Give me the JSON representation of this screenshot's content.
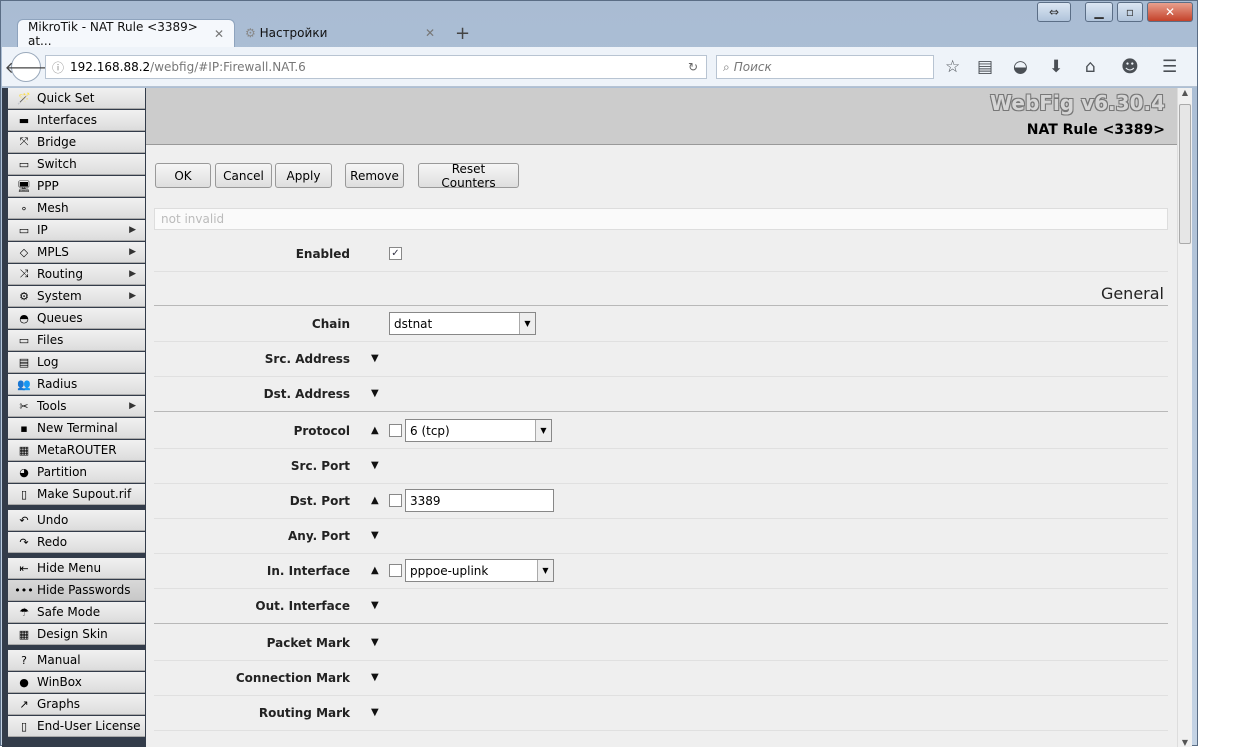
{
  "browser": {
    "tabs": [
      {
        "label": "MikroTik - NAT Rule <3389> at..."
      },
      {
        "label": "Настройки"
      }
    ],
    "new_tab": "+",
    "close": "✕",
    "url_domain": "192.168.88.2",
    "url_path": "/webfig/#IP:Firewall.NAT.6",
    "search_placeholder": "Поиск"
  },
  "sidebar": {
    "items": [
      {
        "label": "Quick Set",
        "icon": "🪄"
      },
      {
        "label": "Interfaces",
        "icon": "▬"
      },
      {
        "label": "Bridge",
        "icon": "⤧"
      },
      {
        "label": "Switch",
        "icon": "▭"
      },
      {
        "label": "PPP",
        "icon": "🖥"
      },
      {
        "label": "Mesh",
        "icon": "∘"
      },
      {
        "label": "IP",
        "icon": "▭",
        "sub": true
      },
      {
        "label": "MPLS",
        "icon": "◇",
        "sub": true
      },
      {
        "label": "Routing",
        "icon": "⤨",
        "sub": true
      },
      {
        "label": "System",
        "icon": "⚙",
        "sub": true
      },
      {
        "label": "Queues",
        "icon": "◓"
      },
      {
        "label": "Files",
        "icon": "▭"
      },
      {
        "label": "Log",
        "icon": "▤"
      },
      {
        "label": "Radius",
        "icon": "👥"
      },
      {
        "label": "Tools",
        "icon": "✂",
        "sub": true
      },
      {
        "label": "New Terminal",
        "icon": "▪"
      },
      {
        "label": "MetaROUTER",
        "icon": "▦"
      },
      {
        "label": "Partition",
        "icon": "◕"
      },
      {
        "label": "Make Supout.rif",
        "icon": "▯"
      },
      {
        "label": "Undo",
        "icon": "↶"
      },
      {
        "label": "Redo",
        "icon": "↷"
      },
      {
        "label": "Hide Menu",
        "icon": "⇤"
      },
      {
        "label": "Hide Passwords",
        "icon": "•••"
      },
      {
        "label": "Safe Mode",
        "icon": "☂"
      },
      {
        "label": "Design Skin",
        "icon": "▦"
      },
      {
        "label": "Manual",
        "icon": "?"
      },
      {
        "label": "WinBox",
        "icon": "●"
      },
      {
        "label": "Graphs",
        "icon": "↗"
      },
      {
        "label": "End-User License",
        "icon": "▯"
      }
    ]
  },
  "header": {
    "version": "WebFig v6.30.4",
    "title": "NAT Rule <3389>"
  },
  "toolbar": {
    "ok": "OK",
    "cancel": "Cancel",
    "apply": "Apply",
    "remove": "Remove",
    "reset": "Reset Counters"
  },
  "status": "not invalid",
  "form": {
    "enabled_label": "Enabled",
    "section": "General",
    "chain_label": "Chain",
    "chain": "dstnat",
    "src_address": "Src. Address",
    "dst_address": "Dst. Address",
    "protocol_label": "Protocol",
    "protocol": "6 (tcp)",
    "src_port": "Src. Port",
    "dst_port_label": "Dst. Port",
    "dst_port": "3389",
    "any_port": "Any. Port",
    "in_interface_label": "In. Interface",
    "in_interface": "pppoe-uplink",
    "out_interface": "Out. Interface",
    "packet_mark": "Packet Mark",
    "connection_mark": "Connection Mark",
    "routing_mark": "Routing Mark"
  }
}
